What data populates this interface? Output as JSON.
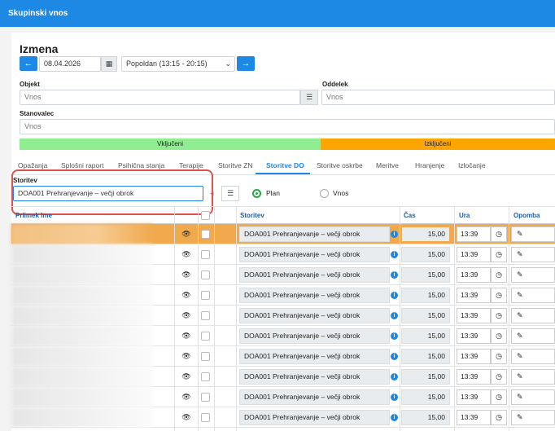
{
  "window": {
    "title": "Skupinski vnos"
  },
  "heading": "Izmena",
  "date": {
    "value": "08.04.2026",
    "prev_icon": "arrow-left-icon",
    "next_icon": "arrow-right-icon",
    "calendar_icon": "calendar-icon"
  },
  "shift": {
    "selected": "Popoldan (13:15 - 20:15)"
  },
  "objekt": {
    "label": "Objekt",
    "placeholder": "Vnos"
  },
  "oddelek": {
    "label": "Oddelek",
    "placeholder": "Vnos"
  },
  "stanovalec": {
    "label": "Stanovalec",
    "placeholder": "Vnos"
  },
  "status_bar": {
    "included": "Vključeni",
    "excluded": "Izključeni",
    "included_color": "#90ee90",
    "excluded_color": "#ffa500"
  },
  "tabs": [
    {
      "label": "Opažanja"
    },
    {
      "label": "Splošni raport"
    },
    {
      "label": "Psihična stanja"
    },
    {
      "label": "Terapije"
    },
    {
      "label": "Storitve ZN"
    },
    {
      "label": "Storitve DO"
    },
    {
      "label": "Storitve oskrbe"
    },
    {
      "label": "Meritve"
    },
    {
      "label": "Hranjenje"
    },
    {
      "label": "Izločanje"
    }
  ],
  "filter": {
    "label": "Storitev",
    "value": "DOA001 Prehranjevanje – večji obrok",
    "plan_label": "Plan",
    "vnos_label": "Vnos"
  },
  "table": {
    "columns": {
      "name": "Priimek Ime",
      "service": "Storitev",
      "time": "Čas",
      "hour": "Ura",
      "note": "Opomba"
    },
    "rows": [
      {
        "service": "DOA001 Prehranjevanje – večji obrok",
        "cas": "15,00",
        "ura": "13:39"
      },
      {
        "service": "DOA001 Prehranjevanje – večji obrok",
        "cas": "15,00",
        "ura": "13:39"
      },
      {
        "service": "DOA001 Prehranjevanje – večji obrok",
        "cas": "15,00",
        "ura": "13:39"
      },
      {
        "service": "DOA001 Prehranjevanje – večji obrok",
        "cas": "15,00",
        "ura": "13:39"
      },
      {
        "service": "DOA001 Prehranjevanje – večji obrok",
        "cas": "15,00",
        "ura": "13:39"
      },
      {
        "service": "DOA001 Prehranjevanje – večji obrok",
        "cas": "15,00",
        "ura": "13:39"
      },
      {
        "service": "DOA001 Prehranjevanje – večji obrok",
        "cas": "15,00",
        "ura": "13:39"
      },
      {
        "service": "DOA001 Prehranjevanje – večji obrok",
        "cas": "15,00",
        "ura": "13:39"
      },
      {
        "service": "DOA001 Prehranjevanje – večji obrok",
        "cas": "15,00",
        "ura": "13:39"
      },
      {
        "service": "DOA001 Prehranjevanje – večji obrok",
        "cas": "15,00",
        "ura": "13:39"
      }
    ]
  }
}
